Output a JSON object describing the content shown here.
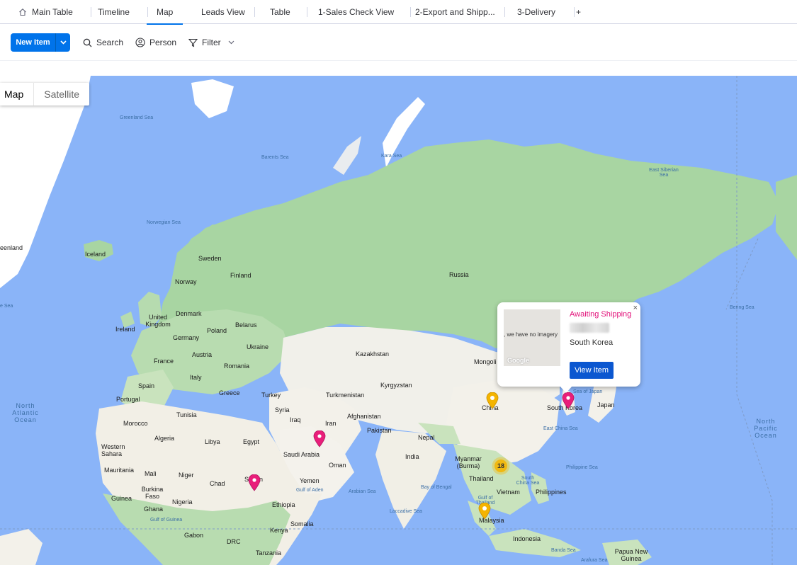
{
  "tabs": [
    {
      "label": "Main Table",
      "icon": "home-icon"
    },
    {
      "label": "Timeline"
    },
    {
      "label": "Map",
      "active": true
    },
    {
      "label": "Leads View"
    },
    {
      "label": "Table"
    },
    {
      "label": "1-Sales Check View"
    },
    {
      "label": "2-Export and Shipp..."
    },
    {
      "label": "3-Delivery"
    },
    {
      "label": "+"
    }
  ],
  "toolbar": {
    "new_item_label": "New Item",
    "search_label": "Search",
    "person_label": "Person",
    "filter_label": "Filter"
  },
  "map": {
    "type_map": "Map",
    "type_satellite": "Satellite",
    "labels": {
      "greenland": "eenland",
      "iceland": "Iceland",
      "sweden": "Sweden",
      "finland": "Finland",
      "norway": "Norway",
      "russia": "Russia",
      "united_kingdom": "United Kingdom",
      "ireland": "Ireland",
      "denmark": "Denmark",
      "germany": "Germany",
      "poland": "Poland",
      "belarus": "Belarus",
      "ukraine": "Ukraine",
      "france": "France",
      "austria": "Austria",
      "romania": "Romania",
      "italy": "Italy",
      "spain": "Spain",
      "portugal": "Portugal",
      "greece": "Greece",
      "turkey": "Turkey",
      "kazakhstan": "Kazakhstan",
      "mongolia": "Mongoli",
      "turkmenistan": "Turkmenistan",
      "kyrgyzstan": "Kyrgyzstan",
      "syria": "Syria",
      "iraq": "Iraq",
      "iran": "Iran",
      "afghanistan": "Afghanistan",
      "pakistan": "Pakistan",
      "china": "China",
      "south_korea": "South Korea",
      "japan": "Japan",
      "tunisia": "Tunisia",
      "morocco": "Morocco",
      "algeria": "Algeria",
      "libya": "Libya",
      "egypt": "Egypt",
      "saudi_arabia": "Saudi Arabia",
      "nepal": "Nepal",
      "india": "India",
      "oman": "Oman",
      "yemen": "Yemen",
      "myanmar": "Myanmar (Burma)",
      "thailand": "Thailand",
      "vietnam": "Vietnam",
      "philippines": "Philippines",
      "malaysia": "Malaysia",
      "indonesia": "Indonesia",
      "papua": "Papua New Guinea",
      "western_sahara": "Western Sahara",
      "mauritania": "Mauritania",
      "mali": "Mali",
      "niger": "Niger",
      "chad": "Chad",
      "sudan": "Sudan",
      "burkina": "Burkina Faso",
      "guinea": "Guinea",
      "ghana": "Ghana",
      "nigeria": "Nigeria",
      "ethiopia": "Ethiopia",
      "somalia": "Somalia",
      "kenya": "Kenya",
      "gabon": "Gabon",
      "drc": "DRC",
      "tanzania": "Tanzania"
    },
    "seas": {
      "greenland_sea": "Greenland Sea",
      "barents_sea": "Barents Sea",
      "kara_sea": "Kara Sea",
      "east_siberian": "East Siberian Sea",
      "norwegian_sea": "Norwegian Sea",
      "bering_sea": "Bering Sea",
      "sea_of_japan": "Sea of Japan",
      "east_china_sea": "East China Sea",
      "philippine_sea": "Philippine Sea",
      "south_china_sea": "South China Sea",
      "gulf_of_thailand": "Gulf of Thailand",
      "bay_of_bengal": "Bay of Bengal",
      "arabian_sea": "Arabian Sea",
      "laccadive_sea": "Laccadive Sea",
      "gulf_of_aden": "Gulf of Aden",
      "gulf_of_guinea": "Gulf of Guinea",
      "banda_sea": "Banda Sea",
      "arafura_sea": "Arafura Sea",
      "se_edge": "e Sea"
    },
    "oceans": {
      "north_atlantic": "North Atlantic Ocean",
      "north_pacific": "North Pacific Ocean"
    },
    "cluster_count": "18"
  },
  "infowindow": {
    "status": "Awaiting Shipping",
    "country": "South Korea",
    "button": "View Item",
    "no_imagery": ", we have no imagery",
    "logo": "Google",
    "close": "×"
  },
  "colors": {
    "accent": "#0073ea",
    "status_pink": "#e2127a",
    "pin_pink": "#e91e7a",
    "pin_yellow": "#f4b400",
    "water": "#8ab4f8"
  }
}
